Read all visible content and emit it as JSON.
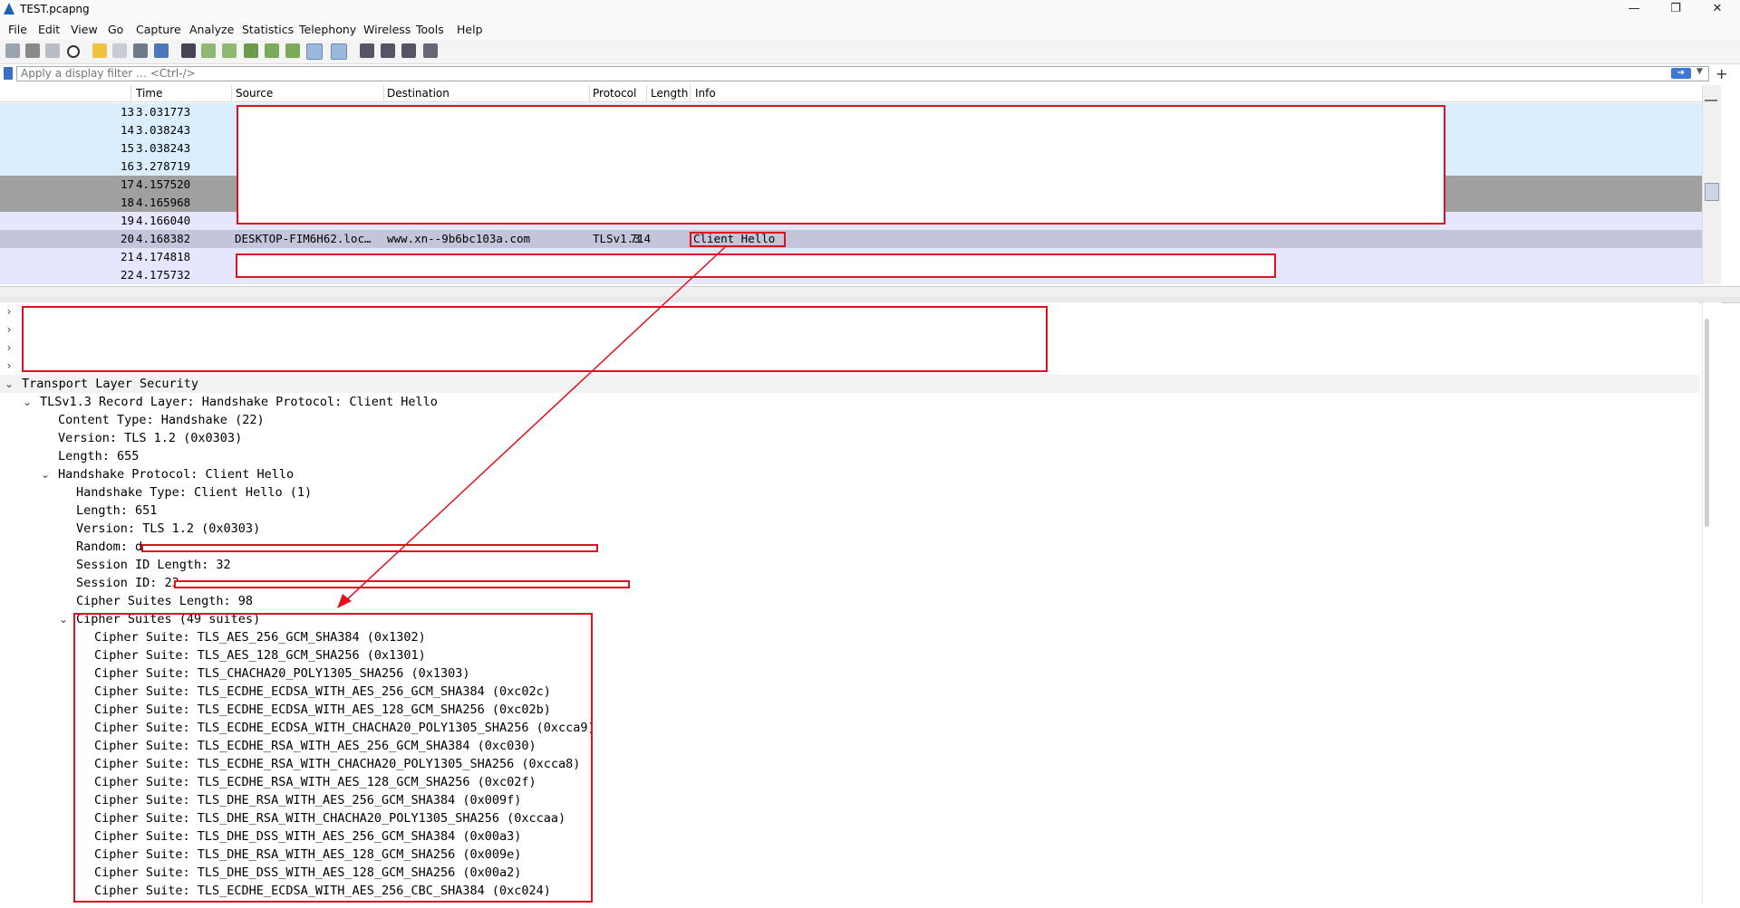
{
  "window": {
    "title": "TEST.pcapng",
    "minimize": "—",
    "maximize": "❐",
    "close": "✕"
  },
  "menu": [
    "File",
    "Edit",
    "View",
    "Go",
    "Capture",
    "Analyze",
    "Statistics",
    "Telephony",
    "Wireless",
    "Tools",
    "Help"
  ],
  "filter": {
    "placeholder": "Apply a display filter … <Ctrl-/>",
    "apply_icon": "arrow-right-icon",
    "add_icon": "+"
  },
  "columns": [
    "Time",
    "Source",
    "Destination",
    "Protocol",
    "Length",
    "Info"
  ],
  "packets": [
    {
      "no": "13",
      "time": "3.031773",
      "source": "",
      "destination": "",
      "protocol": "",
      "length": "",
      "info": "",
      "bg": "#dbeefe"
    },
    {
      "no": "14",
      "time": "3.038243",
      "source": "",
      "destination": "",
      "protocol": "",
      "length": "",
      "info": "",
      "bg": "#dbeefe"
    },
    {
      "no": "15",
      "time": "3.038243",
      "source": "",
      "destination": "",
      "protocol": "",
      "length": "",
      "info": "",
      "bg": "#dbeefe"
    },
    {
      "no": "16",
      "time": "3.278719",
      "source": "",
      "destination": "",
      "protocol": "",
      "length": "",
      "info": "",
      "bg": "#dbeefe"
    },
    {
      "no": "17",
      "time": "4.157520",
      "source": "",
      "destination": "",
      "protocol": "",
      "length": "",
      "info": "",
      "bg": "#a0a0a0"
    },
    {
      "no": "18",
      "time": "4.165968",
      "source": "",
      "destination": "",
      "protocol": "",
      "length": "",
      "info": "",
      "bg": "#a0a0a0"
    },
    {
      "no": "19",
      "time": "4.166040",
      "source": "",
      "destination": "",
      "protocol": "",
      "length": "",
      "info": "",
      "bg": "#e7e6ff"
    },
    {
      "no": "20",
      "time": "4.168382",
      "source": "DESKTOP-FIM6H62.loc…",
      "destination": "www.xn--9b6bc103a.com",
      "protocol": "TLSv1.3",
      "length": "714",
      "info": "Client Hello",
      "bg": "#c4c4da"
    },
    {
      "no": "21",
      "time": "4.174818",
      "source": "",
      "destination": "",
      "protocol": "",
      "length": "",
      "info": "",
      "bg": "#e7e6ff"
    },
    {
      "no": "22",
      "time": "4.175732",
      "source": "",
      "destination": "",
      "protocol": "",
      "length": "",
      "info": "",
      "bg": "#e7e6ff"
    }
  ],
  "details": [
    {
      "indent": 0,
      "chev": "›",
      "text": ""
    },
    {
      "indent": 0,
      "chev": "›",
      "text": ""
    },
    {
      "indent": 0,
      "chev": "›",
      "text": ""
    },
    {
      "indent": 0,
      "chev": "›",
      "text": ""
    },
    {
      "indent": 0,
      "chev": "⌄",
      "text": "Transport Layer Security"
    },
    {
      "indent": 1,
      "chev": "⌄",
      "text": "TLSv1.3 Record Layer: Handshake Protocol: Client Hello"
    },
    {
      "indent": 2,
      "chev": "",
      "text": "Content Type: Handshake (22)"
    },
    {
      "indent": 2,
      "chev": "",
      "text": "Version: TLS 1.2 (0x0303)"
    },
    {
      "indent": 2,
      "chev": "",
      "text": "Length: 655"
    },
    {
      "indent": 2,
      "chev": "⌄",
      "text": "Handshake Protocol: Client Hello"
    },
    {
      "indent": 3,
      "chev": "",
      "text": "Handshake Type: Client Hello (1)"
    },
    {
      "indent": 3,
      "chev": "",
      "text": "Length: 651"
    },
    {
      "indent": 3,
      "chev": "",
      "text": "Version: TLS 1.2 (0x0303)"
    },
    {
      "indent": 3,
      "chev": "",
      "text": "Random: d"
    },
    {
      "indent": 3,
      "chev": "",
      "text": "Session ID Length: 32"
    },
    {
      "indent": 3,
      "chev": "",
      "text": "Session ID: 23"
    },
    {
      "indent": 3,
      "chev": "",
      "text": "Cipher Suites Length: 98"
    },
    {
      "indent": 3,
      "chev": "⌄",
      "text": "Cipher Suites (49 suites)"
    },
    {
      "indent": 4,
      "chev": "",
      "text": "Cipher Suite: TLS_AES_256_GCM_SHA384 (0x1302)"
    },
    {
      "indent": 4,
      "chev": "",
      "text": "Cipher Suite: TLS_AES_128_GCM_SHA256 (0x1301)"
    },
    {
      "indent": 4,
      "chev": "",
      "text": "Cipher Suite: TLS_CHACHA20_POLY1305_SHA256 (0x1303)"
    },
    {
      "indent": 4,
      "chev": "",
      "text": "Cipher Suite: TLS_ECDHE_ECDSA_WITH_AES_256_GCM_SHA384 (0xc02c)"
    },
    {
      "indent": 4,
      "chev": "",
      "text": "Cipher Suite: TLS_ECDHE_ECDSA_WITH_AES_128_GCM_SHA256 (0xc02b)"
    },
    {
      "indent": 4,
      "chev": "",
      "text": "Cipher Suite: TLS_ECDHE_ECDSA_WITH_CHACHA20_POLY1305_SHA256 (0xcca9)"
    },
    {
      "indent": 4,
      "chev": "",
      "text": "Cipher Suite: TLS_ECDHE_RSA_WITH_AES_256_GCM_SHA384 (0xc030)"
    },
    {
      "indent": 4,
      "chev": "",
      "text": "Cipher Suite: TLS_ECDHE_RSA_WITH_CHACHA20_POLY1305_SHA256 (0xcca8)"
    },
    {
      "indent": 4,
      "chev": "",
      "text": "Cipher Suite: TLS_ECDHE_RSA_WITH_AES_128_GCM_SHA256 (0xc02f)"
    },
    {
      "indent": 4,
      "chev": "",
      "text": "Cipher Suite: TLS_DHE_RSA_WITH_AES_256_GCM_SHA384 (0x009f)"
    },
    {
      "indent": 4,
      "chev": "",
      "text": "Cipher Suite: TLS_DHE_RSA_WITH_CHACHA20_POLY1305_SHA256 (0xccaa)"
    },
    {
      "indent": 4,
      "chev": "",
      "text": "Cipher Suite: TLS_DHE_DSS_WITH_AES_256_GCM_SHA384 (0x00a3)"
    },
    {
      "indent": 4,
      "chev": "",
      "text": "Cipher Suite: TLS_DHE_RSA_WITH_AES_128_GCM_SHA256 (0x009e)"
    },
    {
      "indent": 4,
      "chev": "",
      "text": "Cipher Suite: TLS_DHE_DSS_WITH_AES_128_GCM_SHA256 (0x00a2)"
    },
    {
      "indent": 4,
      "chev": "",
      "text": "Cipher Suite: TLS_ECDHE_ECDSA_WITH_AES_256_CBC_SHA384 (0xc024)"
    }
  ],
  "colors": {
    "annotation": "#e0101c",
    "selected_row": "#c4c4da"
  }
}
